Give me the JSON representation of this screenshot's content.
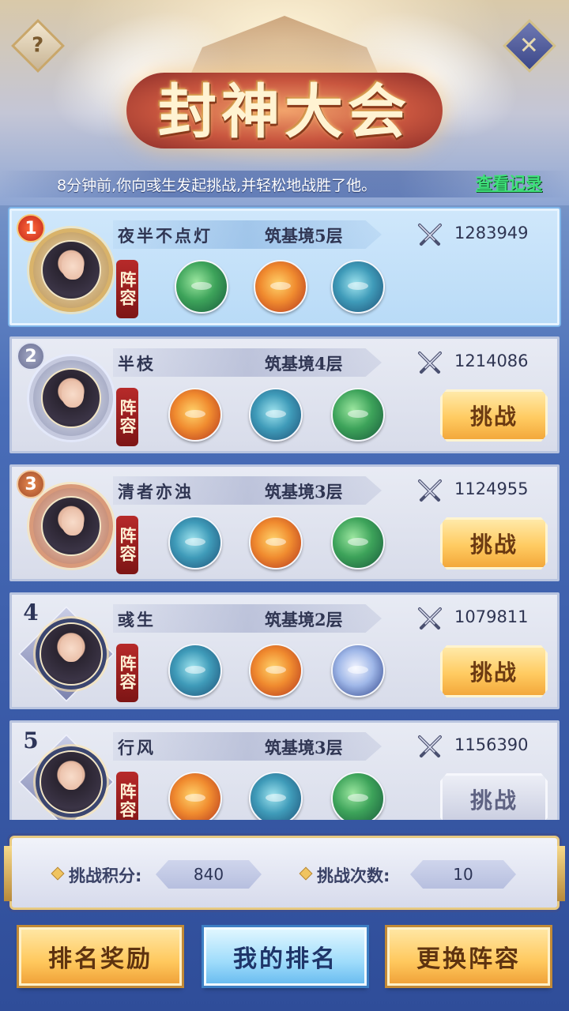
{
  "header": {
    "title": "封神大会",
    "help_icon": "?",
    "close_icon": "✕"
  },
  "notice": {
    "text": "8分钟前,你向彧生发起挑战,并轻松地战胜了他。",
    "record_link": "查看记录"
  },
  "lineup_label": "阵容",
  "challenge_label": "挑战",
  "players": [
    {
      "rank": "1",
      "name": "夜半不点灯",
      "realm": "筑基境5层",
      "power": "1283949",
      "pets": [
        "dragon-green",
        "dragon-gold",
        "whale-blue"
      ],
      "challengeable": false
    },
    {
      "rank": "2",
      "name": "半枝",
      "realm": "筑基境4层",
      "power": "1214086",
      "pets": [
        "dragon-gold",
        "whale-blue",
        "dragon-green"
      ],
      "challengeable": true
    },
    {
      "rank": "3",
      "name": "清者亦浊",
      "realm": "筑基境3层",
      "power": "1124955",
      "pets": [
        "whale-blue",
        "dragon-gold",
        "dragon-green"
      ],
      "challengeable": true
    },
    {
      "rank": "4",
      "name": "彧生",
      "realm": "筑基境2层",
      "power": "1079811",
      "pets": [
        "whale-blue",
        "dragon-gold",
        "dragon-white"
      ],
      "challengeable": true
    },
    {
      "rank": "5",
      "name": "行风",
      "realm": "筑基境3层",
      "power": "1156390",
      "pets": [
        "dragon-gold",
        "whale-blue",
        "dragon-green"
      ],
      "challengeable": true
    }
  ],
  "stats": {
    "points_label": "挑战积分:",
    "points_value": "840",
    "count_label": "挑战次数:",
    "count_value": "10"
  },
  "buttons": {
    "rank_reward": "排名奖励",
    "my_rank": "我的排名",
    "change_lineup": "更换阵容"
  },
  "colors": {
    "accent_gold": "#ffc85d",
    "accent_blue": "#9fdcfb",
    "lineup_red": "#b72a2a",
    "link_green": "#3fe07a"
  }
}
